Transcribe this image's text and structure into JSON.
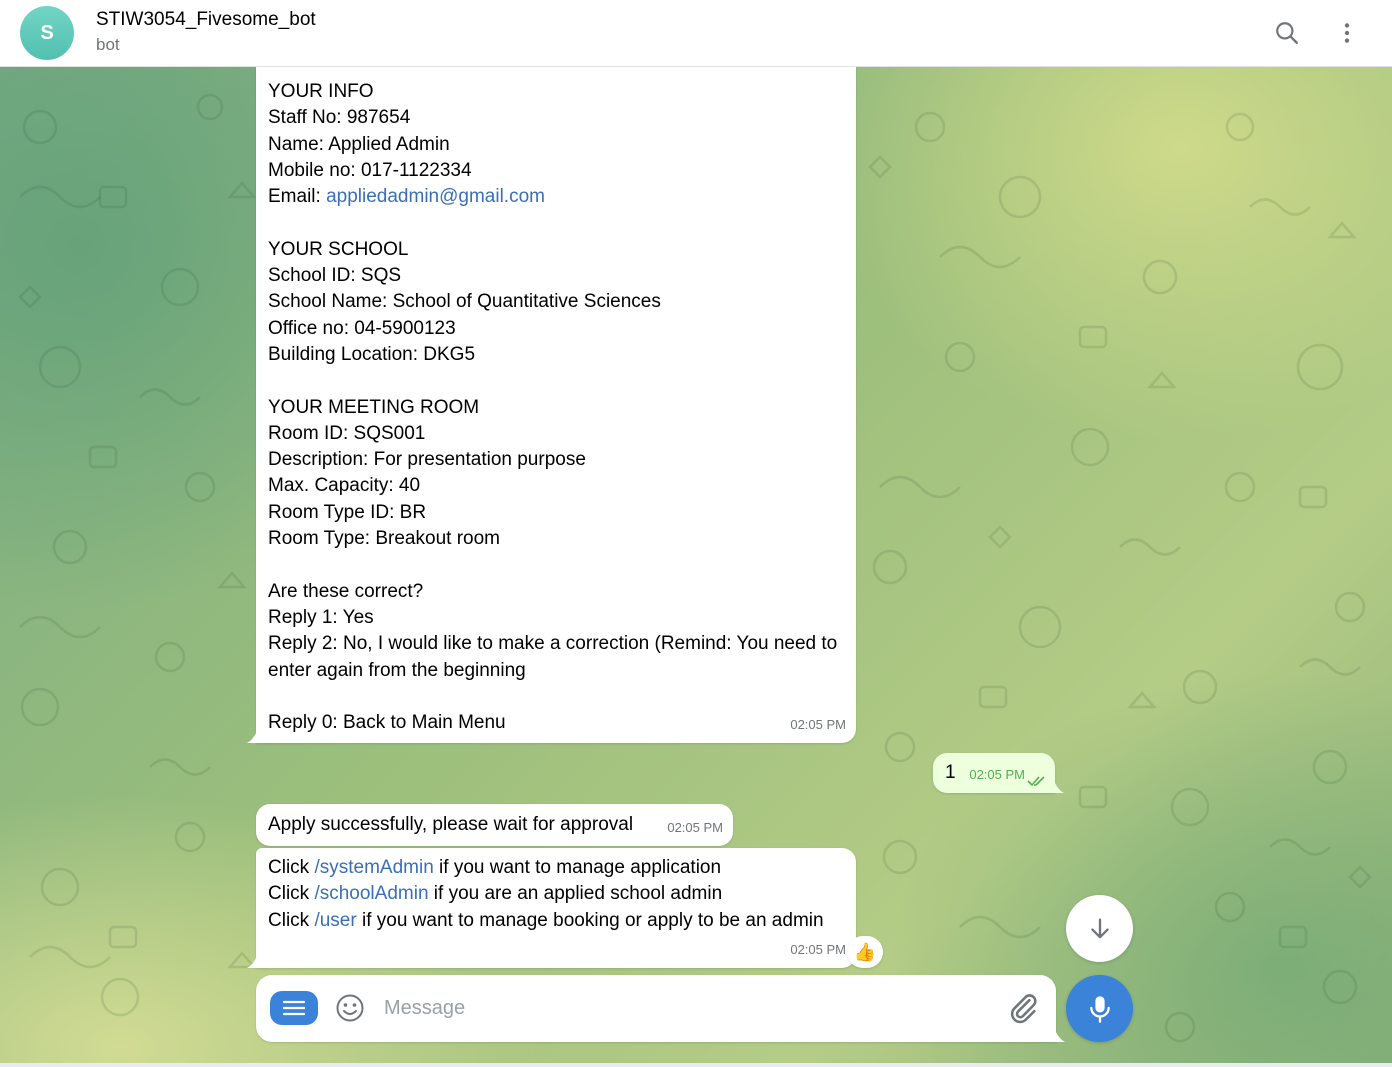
{
  "header": {
    "avatar_letter": "S",
    "title": "STIW3054_Fivesome_bot",
    "status": "bot",
    "icons": [
      "search-icon",
      "more-vertical-icon"
    ]
  },
  "messages": {
    "info": {
      "lines": [
        "YOUR INFO",
        "Staff No: 987654",
        "Name: Applied Admin",
        "Mobile no: 017-1122334",
        "",
        "",
        "YOUR SCHOOL",
        "School ID: SQS",
        "School Name: School of Quantitative Sciences",
        "Office no: 04-5900123",
        "Building Location: DKG5",
        "",
        "YOUR MEETING ROOM",
        "Room ID: SQS001",
        "Description: For presentation purpose",
        "Max. Capacity: 40",
        "Room Type ID: BR",
        "Room Type: Breakout room",
        "",
        "Are these correct?",
        "Reply 1: Yes",
        "Reply 2: No, I would like to make a correction (Remind: You need to enter again from the beginning",
        "",
        "Reply 0: Back to Main Menu"
      ],
      "email_label": "Email: ",
      "email_link": "appliedadmin@gmail.com",
      "time": "02:05 PM"
    },
    "outgoing": {
      "text": "1",
      "time": "02:05 PM",
      "status_icon": "double-check-icon"
    },
    "apply": {
      "text": "Apply successfully, please wait for approval",
      "time": "02:05 PM"
    },
    "commands": {
      "line1_prefix": "Click ",
      "line1_link": "/systemAdmin",
      "line1_suffix": " if you want to manage application",
      "line2_prefix": "Click ",
      "line2_link": "/schoolAdmin",
      "line2_suffix": " if you are an applied school admin",
      "line3_prefix": "Click ",
      "line3_link": "/user",
      "line3_suffix": " if you want to manage booking or apply to be an admin",
      "time": "02:05 PM",
      "reaction": "👍"
    }
  },
  "composer": {
    "placeholder": "Message",
    "value": "",
    "icons": [
      "menu-icon",
      "emoji-icon",
      "attach-icon",
      "microphone-icon"
    ]
  },
  "scroll_down_icon": "arrow-down-icon",
  "colors": {
    "accent": "#3b82d9",
    "outgoing_bubble": "#eeffde",
    "outgoing_time": "#4fae4e",
    "link": "#3a6fb5",
    "avatar": "#5ec8b8"
  }
}
